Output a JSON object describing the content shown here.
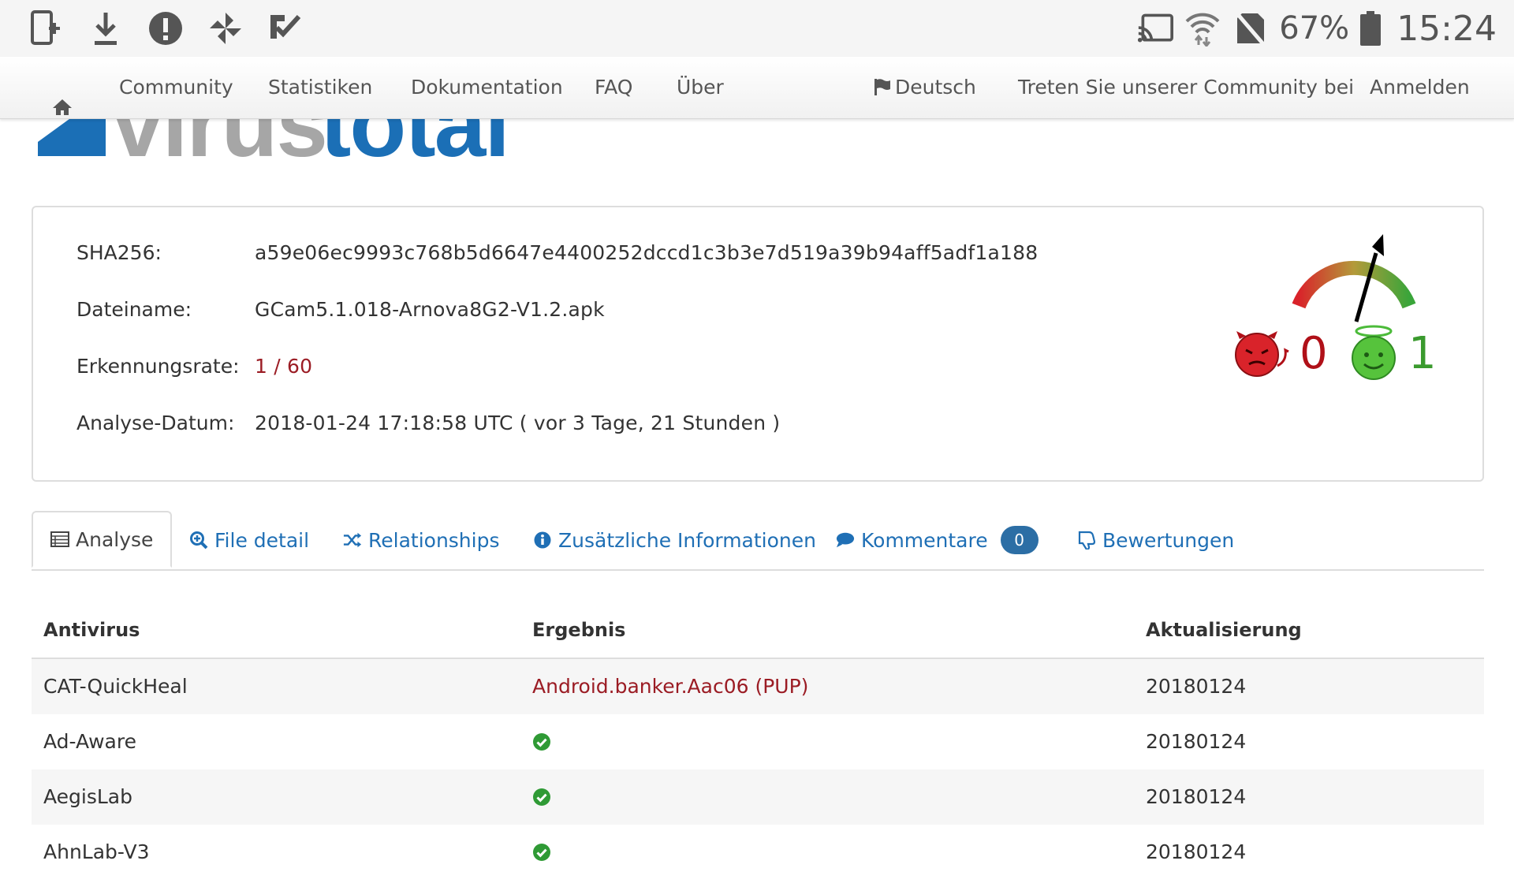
{
  "status_bar": {
    "battery_percent": "67%",
    "time": "15:24",
    "left_icons": [
      "tablet-add-icon",
      "download-icon",
      "alert-icon",
      "pinwheel-icon",
      "checkmark-pen-icon"
    ],
    "right_icons": [
      "cast-icon",
      "wifi-icon",
      "no-sim-icon",
      "battery-icon"
    ]
  },
  "nav": {
    "home_icon": "home-icon",
    "community": "Community",
    "statistics": "Statistiken",
    "documentation": "Dokumentation",
    "faq": "FAQ",
    "about": "Über",
    "language": "Deutsch",
    "join": "Treten Sie unserer Community bei",
    "login": "Anmelden"
  },
  "summary": {
    "sha_label": "SHA256:",
    "sha_value": "a59e06ec9993c768b5d6647e4400252dccd1c3b3e7d519a39b94aff5adf1a188",
    "filename_label": "Dateiname:",
    "filename_value": "GCam5.1.018-Arnova8G2-V1.2.apk",
    "detection_label": "Erkennungsrate:",
    "detection_value": "1 / 60",
    "date_label": "Analyse-Datum:",
    "date_value": "2018-01-24 17:18:58 UTC ( vor 3 Tage, 21 Stunden )",
    "votes_bad": "0",
    "votes_good": "1",
    "colors": {
      "bad": "#b01018",
      "good": "#3a9a2e"
    }
  },
  "tabs": [
    {
      "label": "Analyse",
      "icon": "table-icon"
    },
    {
      "label": "File detail",
      "icon": "zoom-in-icon"
    },
    {
      "label": "Relationships",
      "icon": "shuffle-icon"
    },
    {
      "label": "Zusätzliche Informationen",
      "icon": "info-icon"
    },
    {
      "label": "Kommentare",
      "icon": "comment-icon",
      "badge": "0"
    },
    {
      "label": "Bewertungen",
      "icon": "thumbs-down-icon"
    }
  ],
  "table": {
    "headers": [
      "Antivirus",
      "Ergebnis",
      "Aktualisierung"
    ],
    "rows": [
      {
        "av": "CAT-QuickHeal",
        "result": "Android.banker.Aac06 (PUP)",
        "clean": false,
        "updated": "20180124"
      },
      {
        "av": "Ad-Aware",
        "result": "",
        "clean": true,
        "updated": "20180124"
      },
      {
        "av": "AegisLab",
        "result": "",
        "clean": true,
        "updated": "20180124"
      },
      {
        "av": "AhnLab-V3",
        "result": "",
        "clean": true,
        "updated": "20180124"
      }
    ]
  }
}
